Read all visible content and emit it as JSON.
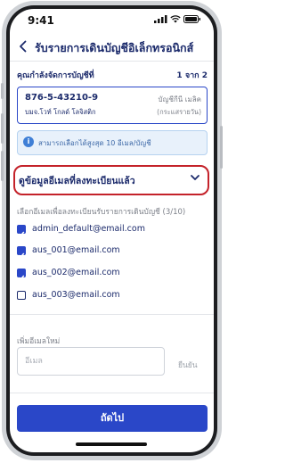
{
  "status_bar": {
    "time": "9:41"
  },
  "header": {
    "back_icon": "chevron-left-icon",
    "title": "รับรายการเดินบัญชีอิเล็กทรอนิกส์"
  },
  "account_section": {
    "label": "คุณกำลังจัดการบัญชีที่",
    "page_indicator": "1 จาก 2",
    "account_number": "876-5-43210-9",
    "account_name": "บมจ.โวท์ โกลด์ โลจิสติก",
    "account_type": "บัญชีกีนี เมลิค",
    "account_subtype": "(กระแสรายวัน)"
  },
  "info_banner": {
    "icon": "info-icon",
    "text": "สามารถเลือกได้สูงสุด 10 อีเมล/บัญชี"
  },
  "dropdown": {
    "label": "ดูข้อมูลอีเมลที่ลงทะเบียนแล้ว",
    "icon": "chevron-down-icon"
  },
  "email_list": {
    "label": "เลือกอีเมลเพื่อลงทะเบียนรับรายการเดินบัญชี (3/10)",
    "items": [
      {
        "email": "admin_default@email.com",
        "checked": true
      },
      {
        "email": "aus_001@email.com",
        "checked": true
      },
      {
        "email": "aus_002@email.com",
        "checked": true
      },
      {
        "email": "aus_003@email.com",
        "checked": false
      }
    ]
  },
  "add_email": {
    "label": "เพิ่มอีเมลใหม่",
    "placeholder": "อีเมล",
    "confirm_label": "ยืนยัน"
  },
  "footer": {
    "next_label": "ถัดไป"
  },
  "colors": {
    "primary": "#2a47c8",
    "navy_text": "#1b2a6b",
    "highlight_red": "#c4222a",
    "info_bg": "#e8f1fb"
  }
}
